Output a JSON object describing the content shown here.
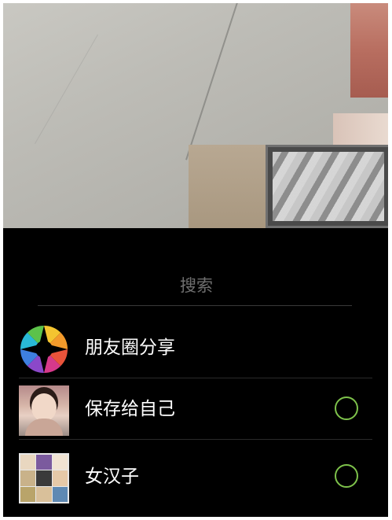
{
  "search": {
    "placeholder": "搜索"
  },
  "list": [
    {
      "label": "朋友圈分享",
      "type": "moments",
      "has_selector": false
    },
    {
      "label": "保存给自己",
      "type": "person",
      "has_selector": true,
      "selected": false
    },
    {
      "label": "女汉子",
      "type": "group",
      "has_selector": true,
      "selected": false
    }
  ],
  "colors": {
    "background": "#000000",
    "selector_accent": "#7ec24b",
    "label_text": "#ffffff",
    "placeholder_text": "#6f6f6f"
  }
}
